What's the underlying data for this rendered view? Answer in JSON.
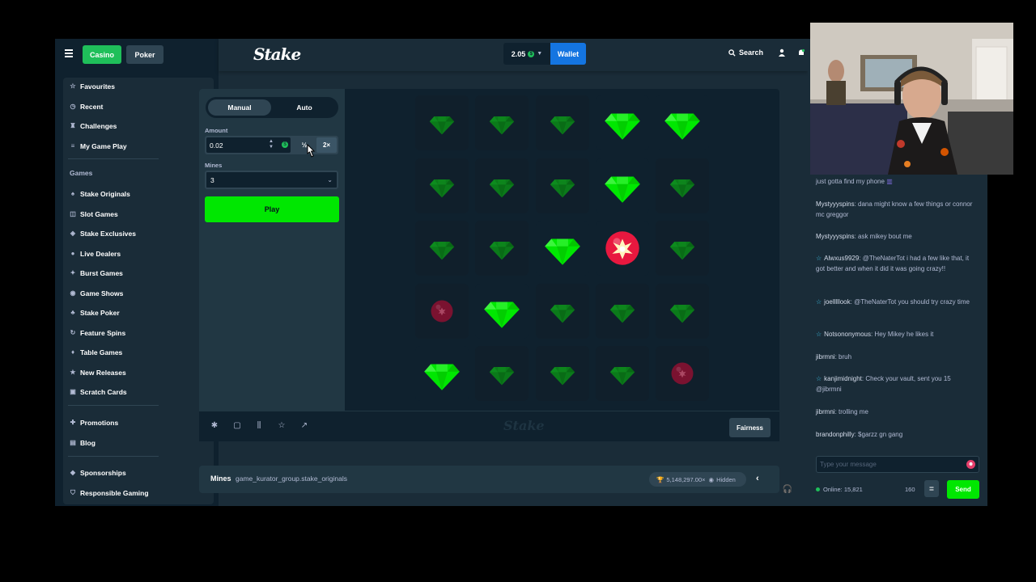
{
  "nav": {
    "tab_casino": "Casino",
    "tab_poker": "Poker",
    "items_top": [
      "Favourites",
      "Recent",
      "Challenges",
      "My Game Play"
    ],
    "games_heading": "Games",
    "games_items": [
      "Stake Originals",
      "Slot Games",
      "Stake Exclusives",
      "Live Dealers",
      "Burst Games",
      "Game Shows",
      "Stake Poker",
      "Feature Spins",
      "Table Games",
      "New Releases",
      "Scratch Cards"
    ],
    "promotions": "Promotions",
    "blog": "Blog",
    "sponsorships": "Sponsorships",
    "responsible": "Responsible Gaming"
  },
  "header": {
    "logo": "Stake",
    "balance": "2.05",
    "wallet": "Wallet",
    "search": "Search"
  },
  "controls": {
    "manual": "Manual",
    "auto": "Auto",
    "amount_label": "Amount",
    "amount_value": "0.02",
    "half": "½",
    "double": "2×",
    "mines_label": "Mines",
    "mines_value": "3",
    "play": "Play"
  },
  "board": {
    "rows": [
      [
        "gem-dim",
        "gem-dim",
        "gem-dim",
        "gem",
        "gem"
      ],
      [
        "gem-dim",
        "gem-dim",
        "gem-dim",
        "gem",
        "gem-dim"
      ],
      [
        "gem-dim",
        "gem-dim",
        "gem",
        "mine-hit",
        "gem-dim"
      ],
      [
        "mine-dim",
        "gem",
        "gem-dim",
        "gem-dim",
        "gem-dim"
      ],
      [
        "gem",
        "gem-dim",
        "gem-dim",
        "gem-dim",
        "mine-dim"
      ]
    ],
    "colors": {
      "gem": "#00e701",
      "gem_dim": "#0b7a1a",
      "mine": "#e8183f",
      "mine_dim": "#7a1230"
    }
  },
  "footer": {
    "watermark": "Stake",
    "fairness": "Fairness"
  },
  "info": {
    "game_name": "Mines",
    "game_slug": "game_kurator_group.stake_originals",
    "record": "5,148,297.00×",
    "hidden": "Hidden"
  },
  "chat": {
    "messages": [
      {
        "user": "",
        "text": "just gotta find my phone",
        "star": false
      },
      {
        "user": "Mystyyyspins",
        "text": ": dana might know a few things or connor mc greggor",
        "star": false
      },
      {
        "user": "Mystyyyspins",
        "text": ": ask mikey bout me",
        "star": false
      },
      {
        "user": "Alwxus9929",
        "text": ": @TheNaterTot i had a few like that, it got better and when it did it was going crazy!!",
        "star": true
      },
      {
        "user": "joelllllook",
        "text": ": @TheNaterTot you should try crazy time",
        "star": true
      },
      {
        "user": "Notsononymous",
        "text": ": Hey Mikey he likes it",
        "star": true
      },
      {
        "user": "jibrmni",
        "text": ": bruh",
        "star": false
      },
      {
        "user": "kanjimidnight",
        "text": ": Check your vault, sent you 15 @jibrmni",
        "star": true
      },
      {
        "user": "jibrmni",
        "text": ": trolling me",
        "star": false
      },
      {
        "user": "brandonphilly",
        "text": ": $garzz gn gang",
        "star": false
      }
    ],
    "input_placeholder": "Type your message",
    "online": "Online: 15,821",
    "char_limit": "160",
    "send": "Send"
  }
}
